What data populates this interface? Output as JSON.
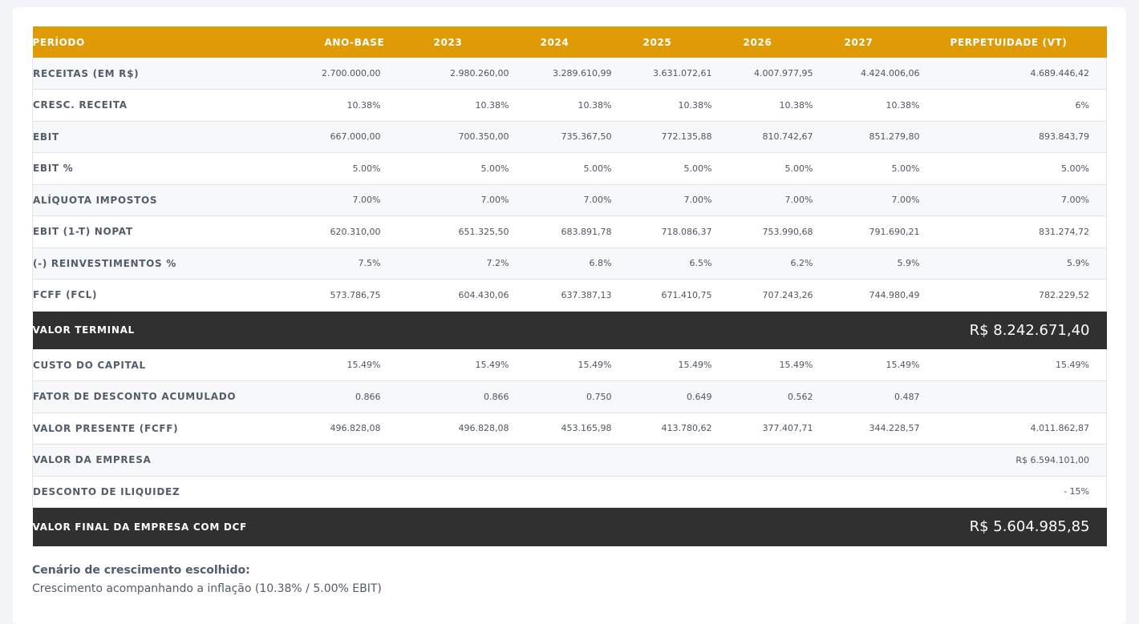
{
  "table": {
    "columns": [
      "PERÍODO",
      "ANO-BASE",
      "2023",
      "2024",
      "2025",
      "2026",
      "2027",
      "PERPETUIDADE (VT)"
    ],
    "rows_a": [
      {
        "label": "RECEITAS (EM R$)",
        "values": [
          "2.700.000,00",
          "2.980.260,00",
          "3.289.610,99",
          "3.631.072,61",
          "4.007.977,95",
          "4.424.006,06",
          "4.689.446,42"
        ]
      },
      {
        "label": "CRESC. RECEITA",
        "values": [
          "10.38%",
          "10.38%",
          "10.38%",
          "10.38%",
          "10.38%",
          "10.38%",
          "6%"
        ]
      },
      {
        "label": "EBIT",
        "values": [
          "667.000,00",
          "700.350,00",
          "735.367,50",
          "772.135,88",
          "810.742,67",
          "851.279,80",
          "893.843,79"
        ]
      },
      {
        "label": "EBIT %",
        "values": [
          "5.00%",
          "5.00%",
          "5.00%",
          "5.00%",
          "5.00%",
          "5.00%",
          "5.00%"
        ]
      },
      {
        "label": "ALÍQUOTA IMPOSTOS",
        "values": [
          "7.00%",
          "7.00%",
          "7.00%",
          "7.00%",
          "7.00%",
          "7.00%",
          "7.00%"
        ]
      },
      {
        "label": "EBIT (1-T) NOPAT",
        "values": [
          "620.310,00",
          "651.325,50",
          "683.891,78",
          "718.086,37",
          "753.990,68",
          "791.690,21",
          "831.274,72"
        ]
      },
      {
        "label": "(-) REINVESTIMENTOS %",
        "values": [
          "7.5%",
          "7.2%",
          "6.8%",
          "6.5%",
          "6.2%",
          "5.9%",
          "5.9%"
        ]
      },
      {
        "label": "FCFF (FCL)",
        "values": [
          "573.786,75",
          "604.430,06",
          "637.387,13",
          "671.410,75",
          "707.243,26",
          "744.980,49",
          "782.229,52"
        ]
      }
    ],
    "terminal": {
      "label": "VALOR TERMINAL",
      "value": "R$ 8.242.671,40"
    },
    "rows_b": [
      {
        "label": "CUSTO DO CAPITAL",
        "values": [
          "15.49%",
          "15.49%",
          "15.49%",
          "15.49%",
          "15.49%",
          "15.49%",
          "15.49%"
        ]
      },
      {
        "label": "FATOR DE DESCONTO ACUMULADO",
        "values": [
          "0.866",
          "0.866",
          "0.750",
          "0.649",
          "0.562",
          "0.487",
          ""
        ]
      },
      {
        "label": "VALOR PRESENTE (FCFF)",
        "values": [
          "496.828,08",
          "496.828,08",
          "453.165,98",
          "413.780,62",
          "377.407,71",
          "344.228,57",
          "4.011.862,87"
        ]
      },
      {
        "label": "VALOR DA EMPRESA",
        "values": [
          "",
          "",
          "",
          "",
          "",
          "",
          "R$ 6.594.101,00"
        ]
      },
      {
        "label": "DESCONTO DE ILIQUIDEZ",
        "values": [
          "",
          "",
          "",
          "",
          "",
          "",
          "- 15%"
        ]
      }
    ],
    "final": {
      "label": "VALOR FINAL DA EMPRESA COM DCF",
      "value": "R$ 5.604.985,85"
    }
  },
  "scenario": {
    "title": "Cenário de crescimento escolhido:",
    "text": "Crescimento acompanhando a inflação (10.38% / 5.00% EBIT)"
  }
}
